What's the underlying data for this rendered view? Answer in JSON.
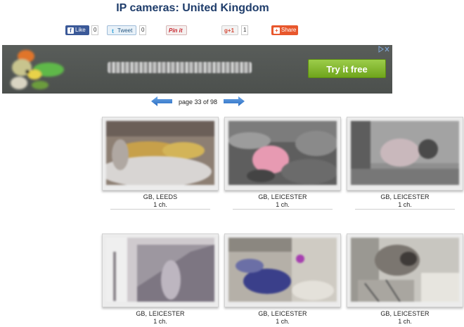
{
  "page_title": "IP cameras: United Kingdom",
  "share": {
    "facebook_label": "Like",
    "facebook_count": "0",
    "twitter_label": "Tweet",
    "twitter_count": "0",
    "pinterest_label": "Pin it",
    "gplus_label": "+1",
    "gplus_count": "1",
    "share_label": "Share"
  },
  "ad": {
    "cta_label": "Try it free",
    "adchoices_icon": "adchoices-icon"
  },
  "pager": {
    "label": "page 33 of 98",
    "prev_icon": "arrow-left-icon",
    "next_icon": "arrow-right-icon"
  },
  "cameras": [
    {
      "location": "GB, LEEDS",
      "channels": "1 ch."
    },
    {
      "location": "GB, LEICESTER",
      "channels": "1 ch."
    },
    {
      "location": "GB, LEICESTER",
      "channels": "1 ch."
    },
    {
      "location": "GB, LEICESTER",
      "channels": "1 ch."
    },
    {
      "location": "GB, LEICESTER",
      "channels": "1 ch."
    },
    {
      "location": "GB, LEICESTER",
      "channels": "1 ch."
    }
  ],
  "colors": {
    "title": "#1f3d6b",
    "facebook": "#3b5998",
    "cta": "#7cb82a",
    "share": "#e8572c",
    "pager_arrow": "#3a7fd0"
  }
}
